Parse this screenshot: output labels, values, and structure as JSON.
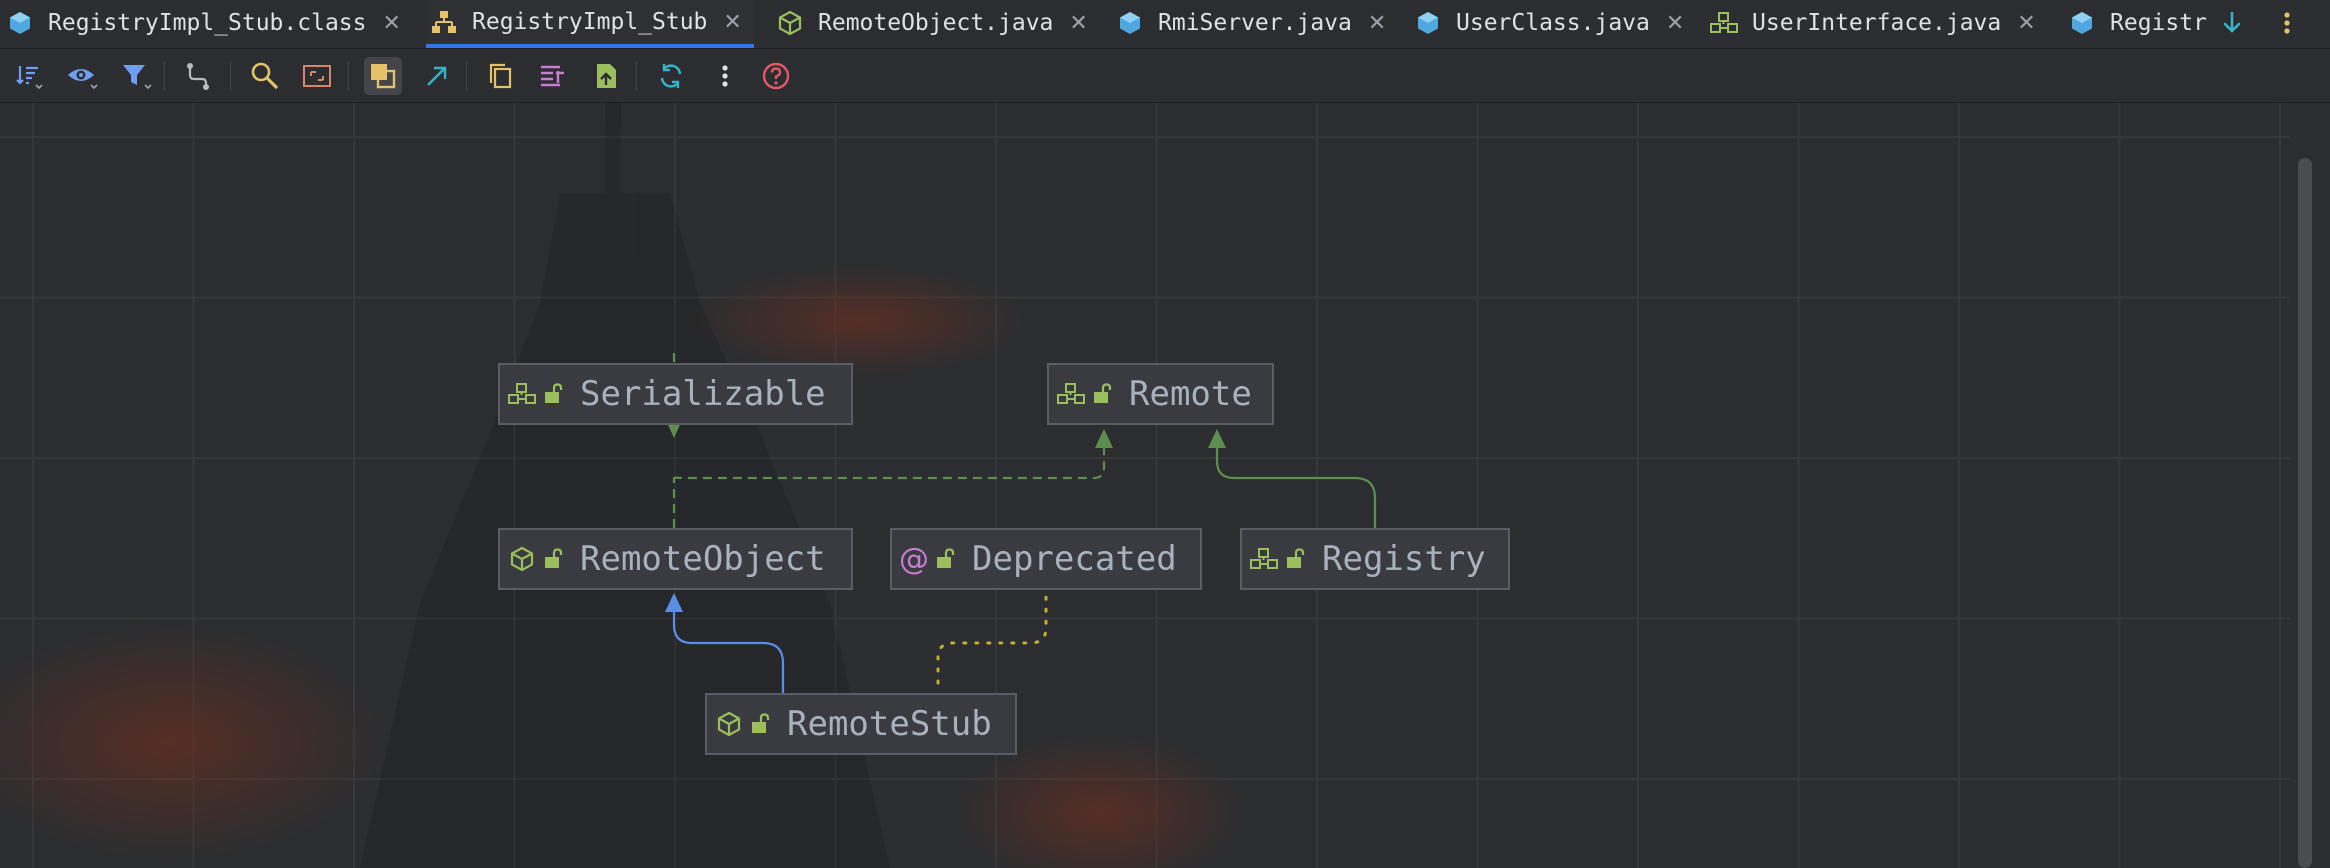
{
  "tabs": [
    {
      "label": "RegistryImpl_Stub.class",
      "icon": "class-file-icon",
      "active": false
    },
    {
      "label": "RegistryImpl_Stub",
      "icon": "hierarchy-diagram-icon",
      "active": true
    },
    {
      "label": "RemoteObject.java",
      "icon": "abstract-class-icon",
      "active": false
    },
    {
      "label": "RmiServer.java",
      "icon": "java-class-icon",
      "active": false
    },
    {
      "label": "UserClass.java",
      "icon": "java-class-icon",
      "active": false
    },
    {
      "label": "UserInterface.java",
      "icon": "interface-icon",
      "active": false
    },
    {
      "label": "Registr",
      "icon": "java-class-icon",
      "active": false
    }
  ],
  "toolbar": {
    "buttons": [
      "sort-icon",
      "visibility-icon",
      "filter-icon",
      "route-edges-icon",
      "zoom-icon",
      "fit-content-icon",
      "show-dependencies-icon",
      "navigate-icon",
      "copy-icon",
      "layout-icon",
      "export-icon",
      "refresh-icon",
      "more-icon",
      "help-icon"
    ]
  },
  "diagram": {
    "nodes": {
      "serializable": {
        "label": "Serializable",
        "kind": "interface"
      },
      "remote": {
        "label": "Remote",
        "kind": "interface"
      },
      "remote_object": {
        "label": "RemoteObject",
        "kind": "abstract-class"
      },
      "deprecated": {
        "label": "Deprecated",
        "kind": "annotation"
      },
      "registry": {
        "label": "Registry",
        "kind": "interface"
      },
      "remote_stub": {
        "label": "RemoteStub",
        "kind": "abstract-class"
      }
    },
    "edges": [
      {
        "from": "RemoteObject",
        "to": "Serializable",
        "type": "implements"
      },
      {
        "from": "RemoteObject",
        "to": "Remote",
        "type": "implements"
      },
      {
        "from": "Registry",
        "to": "Remote",
        "type": "extends"
      },
      {
        "from": "RemoteStub",
        "to": "RemoteObject",
        "type": "extends"
      },
      {
        "from": "RemoteStub",
        "to": "Deprecated",
        "type": "annotated-by"
      }
    ]
  },
  "colors": {
    "accent": "#3574f0",
    "interface_icon": "#9bbf5d",
    "implements_edge": "#5d8e4e",
    "extends_class_edge": "#5a8ee6",
    "annotation_edge": "#c4b02a",
    "annotation_icon": "#c87dd4"
  }
}
